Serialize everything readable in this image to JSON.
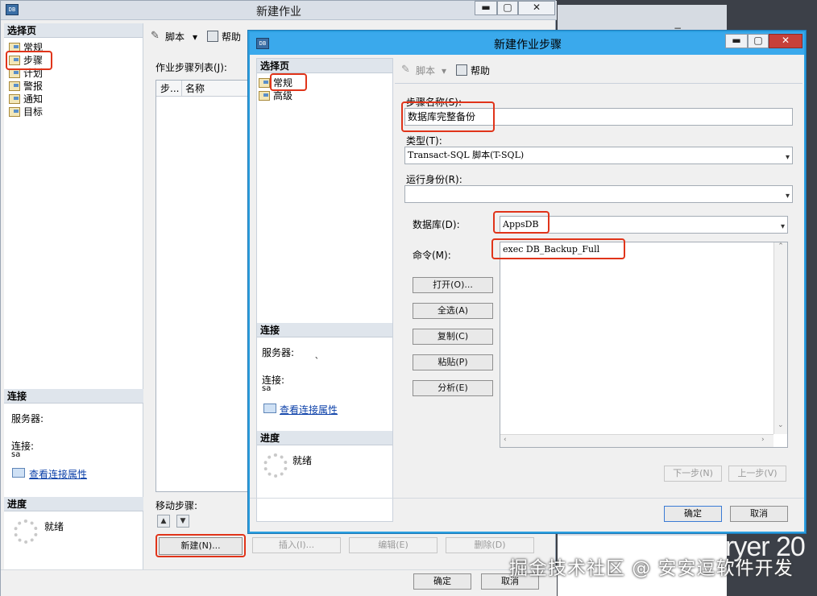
{
  "background": {
    "close_glyphs": "− ×",
    "brand_text": "ryer 20"
  },
  "outer_window": {
    "title": "新建作业",
    "icon_text": "DB",
    "controls": {
      "minimize": "▬",
      "maximize": "▢",
      "close": "✕"
    },
    "select_page_header": "选择页",
    "nav_items": [
      "常规",
      "步骤",
      "计划",
      "警报",
      "通知",
      "目标"
    ],
    "toolbar": {
      "script": "脚本",
      "dropdown": "▾",
      "help": "帮助"
    },
    "steps_list_label": "作业步骤列表(J):",
    "steps_columns": [
      "步...",
      "名称"
    ],
    "connection_header": "连接",
    "server_label": "服务器:",
    "connection_label": "连接:",
    "connection_value": "sa",
    "view_connection_link": "查看连接属性",
    "progress_header": "进度",
    "progress_status": "就绪",
    "move_steps_label": "移动步骤:",
    "up_arrow": "▲",
    "down_arrow": "▼",
    "buttons": {
      "new": "新建(N)...",
      "insert": "插入(I)...",
      "edit": "编辑(E)",
      "delete": "删除(D)"
    },
    "footer_buttons": {
      "ok": "确定",
      "cancel": "取消"
    }
  },
  "step_dialog": {
    "title": "新建作业步骤",
    "icon_text": "DB",
    "controls": {
      "minimize": "▬",
      "maximize": "▢",
      "close": "✕"
    },
    "select_page_header": "选择页",
    "nav_items": [
      "常规",
      "高级"
    ],
    "toolbar": {
      "script": "脚本",
      "dropdown": "▾",
      "help": "帮助"
    },
    "step_name_label": "步骤名称(S):",
    "step_name_value": "数据库完整备份",
    "type_label": "类型(T):",
    "type_value": "Transact-SQL 脚本(T-SQL)",
    "run_as_label": "运行身份(R):",
    "run_as_value": "",
    "database_label": "数据库(D):",
    "database_value": "AppsDB",
    "command_label": "命令(M):",
    "command_value": "exec DB_Backup_Full",
    "command_buttons": {
      "open": "打开(O)...",
      "select_all": "全选(A)",
      "copy": "复制(C)",
      "paste": "粘贴(P)",
      "parse": "分析(E)"
    },
    "connection_header": "连接",
    "server_label": "服务器:",
    "server_value": "、",
    "connection_label": "连接:",
    "connection_value": "sa",
    "view_connection_link": "查看连接属性",
    "progress_header": "进度",
    "progress_status": "就绪",
    "nav_buttons": {
      "next": "下一步(N)",
      "prev": "上一步(V)"
    },
    "footer_buttons": {
      "ok": "确定",
      "cancel": "取消"
    },
    "select_arrow": "▾",
    "scroll": {
      "up": "⌃",
      "down": "⌄",
      "left": "‹",
      "right": "›"
    }
  },
  "watermark": "掘金技术社区 @ 安安逗软件开发"
}
